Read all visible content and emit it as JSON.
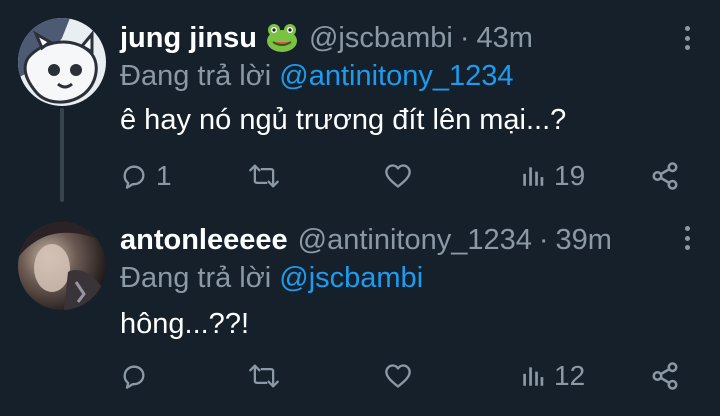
{
  "tweets": [
    {
      "name": "jung jinsu",
      "emoji": "frog-emoji",
      "handle": "@jscbambi",
      "separator": "·",
      "time": "43m",
      "replying_prefix": "Đang trả lời",
      "replying_to": "@antinitony_1234",
      "text": "ê hay nó ngủ trương đít lên mại...?",
      "reply_count": "1",
      "retweet_count": "",
      "like_count": "",
      "view_count": "19"
    },
    {
      "name": "antonleeeee",
      "handle": "@antinitony_1234",
      "separator": "·",
      "time": "39m",
      "replying_prefix": "Đang trả lời",
      "replying_to": "@jscbambi",
      "text": "hông...??!",
      "reply_count": "",
      "retweet_count": "",
      "like_count": "",
      "view_count": "12"
    }
  ],
  "colors": {
    "background": "#15202b",
    "text_primary": "#ffffff",
    "text_secondary": "#8b98a5",
    "link": "#1d9bf0",
    "thread_line": "#38444d"
  }
}
